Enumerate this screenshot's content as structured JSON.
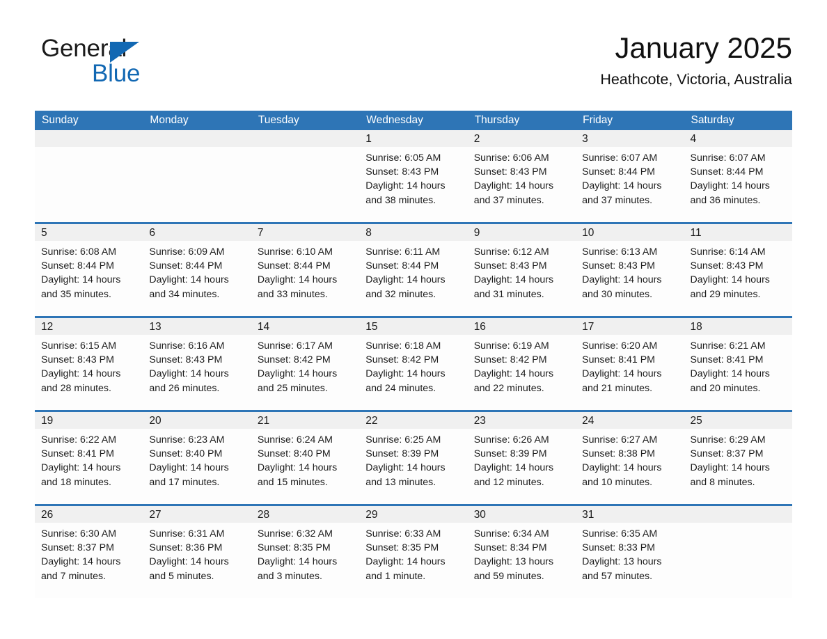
{
  "brand": {
    "name_part1": "General",
    "name_part2": "Blue",
    "triangle_icon": "triangle-icon",
    "accent_color": "#1268b3"
  },
  "header": {
    "title": "January 2025",
    "subtitle": "Heathcote, Victoria, Australia"
  },
  "theme": {
    "header_blue": "#2e75b6",
    "date_band_gray": "#f0f0f0",
    "cell_white": "#fdfdfd",
    "text_dark": "#1c1c1c"
  },
  "calendar": {
    "weekday_headers": [
      "Sunday",
      "Monday",
      "Tuesday",
      "Wednesday",
      "Thursday",
      "Friday",
      "Saturday"
    ],
    "weeks": [
      [
        {
          "day": "",
          "sunrise": "",
          "sunset": "",
          "daylight_line1": "",
          "daylight_line2": "",
          "empty": true
        },
        {
          "day": "",
          "sunrise": "",
          "sunset": "",
          "daylight_line1": "",
          "daylight_line2": "",
          "empty": true
        },
        {
          "day": "",
          "sunrise": "",
          "sunset": "",
          "daylight_line1": "",
          "daylight_line2": "",
          "empty": true
        },
        {
          "day": "1",
          "sunrise": "Sunrise: 6:05 AM",
          "sunset": "Sunset: 8:43 PM",
          "daylight_line1": "Daylight: 14 hours",
          "daylight_line2": "and 38 minutes.",
          "empty": false
        },
        {
          "day": "2",
          "sunrise": "Sunrise: 6:06 AM",
          "sunset": "Sunset: 8:43 PM",
          "daylight_line1": "Daylight: 14 hours",
          "daylight_line2": "and 37 minutes.",
          "empty": false
        },
        {
          "day": "3",
          "sunrise": "Sunrise: 6:07 AM",
          "sunset": "Sunset: 8:44 PM",
          "daylight_line1": "Daylight: 14 hours",
          "daylight_line2": "and 37 minutes.",
          "empty": false
        },
        {
          "day": "4",
          "sunrise": "Sunrise: 6:07 AM",
          "sunset": "Sunset: 8:44 PM",
          "daylight_line1": "Daylight: 14 hours",
          "daylight_line2": "and 36 minutes.",
          "empty": false
        }
      ],
      [
        {
          "day": "5",
          "sunrise": "Sunrise: 6:08 AM",
          "sunset": "Sunset: 8:44 PM",
          "daylight_line1": "Daylight: 14 hours",
          "daylight_line2": "and 35 minutes.",
          "empty": false
        },
        {
          "day": "6",
          "sunrise": "Sunrise: 6:09 AM",
          "sunset": "Sunset: 8:44 PM",
          "daylight_line1": "Daylight: 14 hours",
          "daylight_line2": "and 34 minutes.",
          "empty": false
        },
        {
          "day": "7",
          "sunrise": "Sunrise: 6:10 AM",
          "sunset": "Sunset: 8:44 PM",
          "daylight_line1": "Daylight: 14 hours",
          "daylight_line2": "and 33 minutes.",
          "empty": false
        },
        {
          "day": "8",
          "sunrise": "Sunrise: 6:11 AM",
          "sunset": "Sunset: 8:44 PM",
          "daylight_line1": "Daylight: 14 hours",
          "daylight_line2": "and 32 minutes.",
          "empty": false
        },
        {
          "day": "9",
          "sunrise": "Sunrise: 6:12 AM",
          "sunset": "Sunset: 8:43 PM",
          "daylight_line1": "Daylight: 14 hours",
          "daylight_line2": "and 31 minutes.",
          "empty": false
        },
        {
          "day": "10",
          "sunrise": "Sunrise: 6:13 AM",
          "sunset": "Sunset: 8:43 PM",
          "daylight_line1": "Daylight: 14 hours",
          "daylight_line2": "and 30 minutes.",
          "empty": false
        },
        {
          "day": "11",
          "sunrise": "Sunrise: 6:14 AM",
          "sunset": "Sunset: 8:43 PM",
          "daylight_line1": "Daylight: 14 hours",
          "daylight_line2": "and 29 minutes.",
          "empty": false
        }
      ],
      [
        {
          "day": "12",
          "sunrise": "Sunrise: 6:15 AM",
          "sunset": "Sunset: 8:43 PM",
          "daylight_line1": "Daylight: 14 hours",
          "daylight_line2": "and 28 minutes.",
          "empty": false
        },
        {
          "day": "13",
          "sunrise": "Sunrise: 6:16 AM",
          "sunset": "Sunset: 8:43 PM",
          "daylight_line1": "Daylight: 14 hours",
          "daylight_line2": "and 26 minutes.",
          "empty": false
        },
        {
          "day": "14",
          "sunrise": "Sunrise: 6:17 AM",
          "sunset": "Sunset: 8:42 PM",
          "daylight_line1": "Daylight: 14 hours",
          "daylight_line2": "and 25 minutes.",
          "empty": false
        },
        {
          "day": "15",
          "sunrise": "Sunrise: 6:18 AM",
          "sunset": "Sunset: 8:42 PM",
          "daylight_line1": "Daylight: 14 hours",
          "daylight_line2": "and 24 minutes.",
          "empty": false
        },
        {
          "day": "16",
          "sunrise": "Sunrise: 6:19 AM",
          "sunset": "Sunset: 8:42 PM",
          "daylight_line1": "Daylight: 14 hours",
          "daylight_line2": "and 22 minutes.",
          "empty": false
        },
        {
          "day": "17",
          "sunrise": "Sunrise: 6:20 AM",
          "sunset": "Sunset: 8:41 PM",
          "daylight_line1": "Daylight: 14 hours",
          "daylight_line2": "and 21 minutes.",
          "empty": false
        },
        {
          "day": "18",
          "sunrise": "Sunrise: 6:21 AM",
          "sunset": "Sunset: 8:41 PM",
          "daylight_line1": "Daylight: 14 hours",
          "daylight_line2": "and 20 minutes.",
          "empty": false
        }
      ],
      [
        {
          "day": "19",
          "sunrise": "Sunrise: 6:22 AM",
          "sunset": "Sunset: 8:41 PM",
          "daylight_line1": "Daylight: 14 hours",
          "daylight_line2": "and 18 minutes.",
          "empty": false
        },
        {
          "day": "20",
          "sunrise": "Sunrise: 6:23 AM",
          "sunset": "Sunset: 8:40 PM",
          "daylight_line1": "Daylight: 14 hours",
          "daylight_line2": "and 17 minutes.",
          "empty": false
        },
        {
          "day": "21",
          "sunrise": "Sunrise: 6:24 AM",
          "sunset": "Sunset: 8:40 PM",
          "daylight_line1": "Daylight: 14 hours",
          "daylight_line2": "and 15 minutes.",
          "empty": false
        },
        {
          "day": "22",
          "sunrise": "Sunrise: 6:25 AM",
          "sunset": "Sunset: 8:39 PM",
          "daylight_line1": "Daylight: 14 hours",
          "daylight_line2": "and 13 minutes.",
          "empty": false
        },
        {
          "day": "23",
          "sunrise": "Sunrise: 6:26 AM",
          "sunset": "Sunset: 8:39 PM",
          "daylight_line1": "Daylight: 14 hours",
          "daylight_line2": "and 12 minutes.",
          "empty": false
        },
        {
          "day": "24",
          "sunrise": "Sunrise: 6:27 AM",
          "sunset": "Sunset: 8:38 PM",
          "daylight_line1": "Daylight: 14 hours",
          "daylight_line2": "and 10 minutes.",
          "empty": false
        },
        {
          "day": "25",
          "sunrise": "Sunrise: 6:29 AM",
          "sunset": "Sunset: 8:37 PM",
          "daylight_line1": "Daylight: 14 hours",
          "daylight_line2": "and 8 minutes.",
          "empty": false
        }
      ],
      [
        {
          "day": "26",
          "sunrise": "Sunrise: 6:30 AM",
          "sunset": "Sunset: 8:37 PM",
          "daylight_line1": "Daylight: 14 hours",
          "daylight_line2": "and 7 minutes.",
          "empty": false
        },
        {
          "day": "27",
          "sunrise": "Sunrise: 6:31 AM",
          "sunset": "Sunset: 8:36 PM",
          "daylight_line1": "Daylight: 14 hours",
          "daylight_line2": "and 5 minutes.",
          "empty": false
        },
        {
          "day": "28",
          "sunrise": "Sunrise: 6:32 AM",
          "sunset": "Sunset: 8:35 PM",
          "daylight_line1": "Daylight: 14 hours",
          "daylight_line2": "and 3 minutes.",
          "empty": false
        },
        {
          "day": "29",
          "sunrise": "Sunrise: 6:33 AM",
          "sunset": "Sunset: 8:35 PM",
          "daylight_line1": "Daylight: 14 hours",
          "daylight_line2": "and 1 minute.",
          "empty": false
        },
        {
          "day": "30",
          "sunrise": "Sunrise: 6:34 AM",
          "sunset": "Sunset: 8:34 PM",
          "daylight_line1": "Daylight: 13 hours",
          "daylight_line2": "and 59 minutes.",
          "empty": false
        },
        {
          "day": "31",
          "sunrise": "Sunrise: 6:35 AM",
          "sunset": "Sunset: 8:33 PM",
          "daylight_line1": "Daylight: 13 hours",
          "daylight_line2": "and 57 minutes.",
          "empty": false
        },
        {
          "day": "",
          "sunrise": "",
          "sunset": "",
          "daylight_line1": "",
          "daylight_line2": "",
          "empty": true
        }
      ]
    ]
  }
}
